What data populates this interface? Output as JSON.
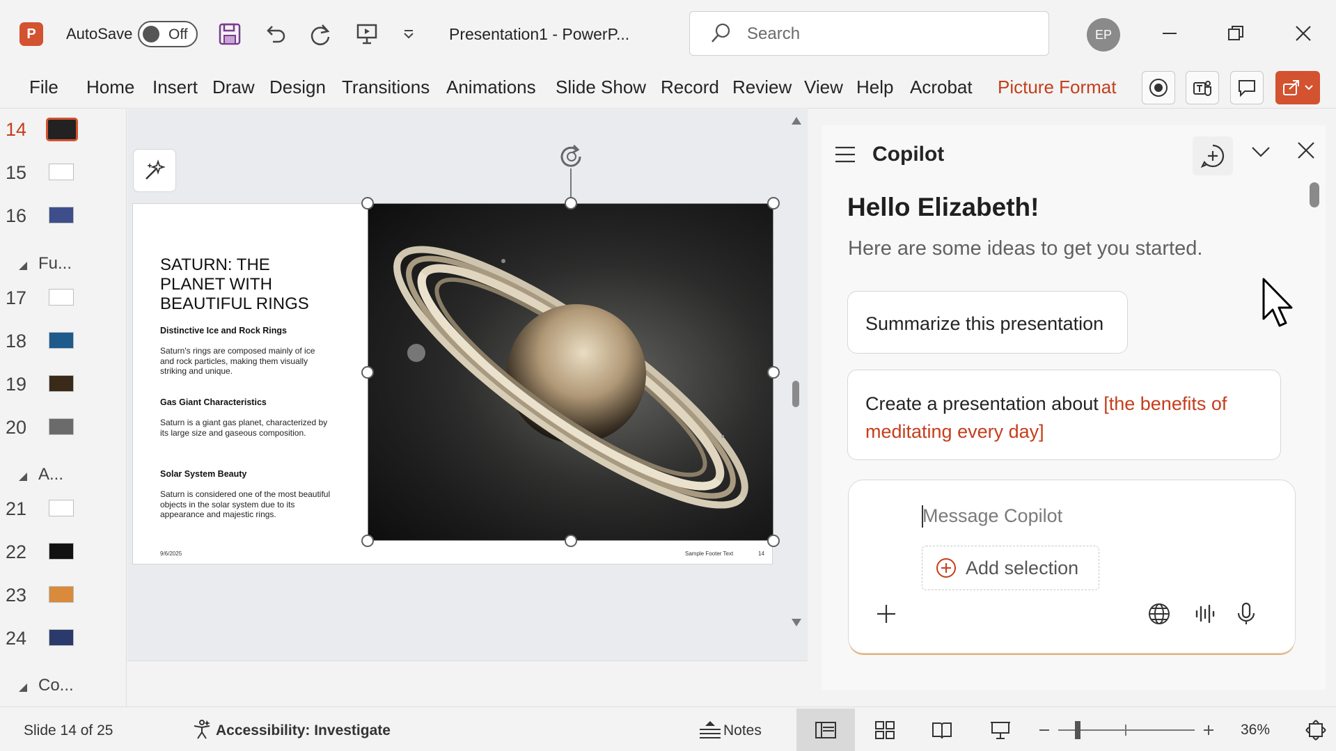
{
  "titlebar": {
    "app_icon": "powerpoint-logo",
    "app_letter": "P",
    "autosave_label": "AutoSave",
    "autosave_state": "Off",
    "document_title": "Presentation1  -  PowerP...",
    "search_placeholder": "Search",
    "user_initials": "EP",
    "icons": [
      "save-icon",
      "undo-icon",
      "redo-icon",
      "start-from-beginning-icon",
      "customize-qat-icon",
      "minimize-icon",
      "restore-icon",
      "close-icon"
    ]
  },
  "ribbon": {
    "tabs": [
      "File",
      "Home",
      "Insert",
      "Draw",
      "Design",
      "Transitions",
      "Animations",
      "Slide Show",
      "Record",
      "Review",
      "View",
      "Help",
      "Acrobat"
    ],
    "contextual_tab": "Picture Format",
    "right_icons": [
      "record-icon",
      "teams-icon",
      "comments-icon",
      "share-icon"
    ]
  },
  "thumbnails": {
    "slides_a": [
      "14",
      "15",
      "16"
    ],
    "section_1": "Fu...",
    "slides_b": [
      "17",
      "18",
      "19",
      "20"
    ],
    "section_2": "A...",
    "slides_c": [
      "21",
      "22",
      "23",
      "24"
    ],
    "section_3": "Co...",
    "active_slide": "14"
  },
  "slide": {
    "title": "SATURN: THE PLANET WITH BEAUTIFUL RINGS",
    "sections": [
      {
        "heading": "Distinctive Ice and Rock Rings",
        "body": "Saturn's rings are composed mainly of ice and rock particles, making them visually striking and unique."
      },
      {
        "heading": "Gas Giant Characteristics",
        "body": "Saturn is a giant gas planet, characterized by its large size and gaseous composition."
      },
      {
        "heading": "Solar System Beauty",
        "body": "Saturn is considered one of the most beautiful objects in the solar system due to its appearance and majestic rings."
      }
    ],
    "date": "9/6/2025",
    "footer": "Sample Footer Text",
    "number": "14"
  },
  "copilot": {
    "title": "Copilot",
    "greeting": "Hello Elizabeth!",
    "subtitle": "Here are some ideas to get you started.",
    "suggestion_1": "Summarize this presentation",
    "suggestion_2_prefix": "Create a presentation about ",
    "suggestion_2_highlight": "[the benefits of meditating every day]",
    "input_placeholder": "Message Copilot",
    "add_selection": "Add selection"
  },
  "statusbar": {
    "slide_info": "Slide 14 of 25",
    "accessibility": "Accessibility: Investigate",
    "notes": "Notes",
    "zoom": "36%"
  },
  "colors": {
    "accent": "#d35230",
    "contextual": "#c43e1c",
    "copilot_highlight": "#c43e1c"
  }
}
